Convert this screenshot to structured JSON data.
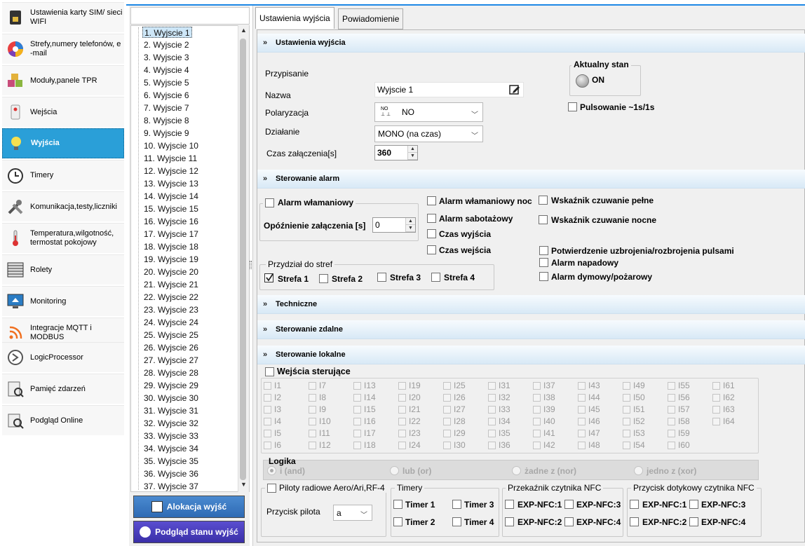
{
  "nav": [
    {
      "label": "Ustawienia karty SIM/ sieci\nWIFI",
      "icon": "sim-card-icon"
    },
    {
      "label": "Strefy,numery telefonów, e\n-mail",
      "icon": "pie-chart-icon"
    },
    {
      "label": "Moduły,panele TPR",
      "icon": "modules-boxes-icon"
    },
    {
      "label": "Wejścia",
      "icon": "sensor-icon"
    },
    {
      "label": "Wyjścia",
      "icon": "lightbulb-icon"
    },
    {
      "label": "Timery",
      "icon": "alarm-clock-icon"
    },
    {
      "label": "Komunikacja,testy,liczniki",
      "icon": "tools-icon"
    },
    {
      "label": "Temperatura,wilgotność,\ntermostat pokojowy",
      "icon": "thermometer-icon"
    },
    {
      "label": "Rolety",
      "icon": "roller-blind-icon"
    },
    {
      "label": "Monitoring",
      "icon": "monitor-house-icon"
    },
    {
      "label": "Integracje MQTT i\nMODBUS",
      "icon": "rss-icon"
    },
    {
      "label": "LogicProcessor",
      "icon": "logic-processor-icon"
    },
    {
      "label": "Pamięć zdarzeń",
      "icon": "event-memory-icon"
    },
    {
      "label": "Podgląd Online",
      "icon": "online-preview-icon"
    }
  ],
  "outputs": [
    "1. Wyjscie 1",
    "2. Wyjscie 2",
    "3. Wyjscie 3",
    "4. Wyjscie 4",
    "5. Wyjscie 5",
    "6. Wyjscie 6",
    "7. Wyjscie 7",
    "8. Wyjscie 8",
    "9. Wyjscie 9",
    "10. Wyjscie 10",
    "11. Wyjscie 11",
    "12. Wyjscie 12",
    "13. Wyjscie 13",
    "14. Wyjscie 14",
    "15. Wyjscie 15",
    "16. Wyjscie 16",
    "17. Wyjscie 17",
    "18. Wyjscie 18",
    "19. Wyjscie 19",
    "20. Wyjscie 20",
    "21. Wyjscie 21",
    "22. Wyjscie 22",
    "23. Wyjscie 23",
    "24. Wyjscie 24",
    "25. Wyjscie 25",
    "26. Wyjscie 26",
    "27. Wyjscie 27",
    "28. Wyjscie 28",
    "29. Wyjscie 29",
    "30. Wyjscie 30",
    "31. Wyjscie 31",
    "32. Wyjscie 32",
    "33. Wyjscie 33",
    "34. Wyjscie 34",
    "35. Wyjscie 35",
    "36. Wyjscie 36",
    "37. Wyjscie 37"
  ],
  "buttons": {
    "alokacja": "Alokacja wyjść",
    "podglad": "Podgląd stanu wyjść"
  },
  "tabs": {
    "settings": "Ustawienia wyjścia",
    "notify": "Powiadomienie"
  },
  "sections": {
    "settings": "Ustawienia wyjścia",
    "alarm": "Sterowanie alarm",
    "technical": "Techniczne",
    "remote": "Sterowanie zdalne",
    "local": "Sterowanie lokalne"
  },
  "settings": {
    "assign_label": "Przypisanie",
    "name_label": "Nazwa",
    "name_value": "Wyjscie 1",
    "polar_label": "Polaryzacja",
    "polar_icon_text": "NO",
    "polar_value": "NO",
    "action_label": "Działanie",
    "action_value": "MONO (na czas)",
    "time_label": "Czas załączenia[s]",
    "time_value": "360",
    "state_group": "Aktualny stan",
    "state_value": "ON",
    "pulse_label": "Pulsowanie ~1s/1s"
  },
  "alarm": {
    "burglary_group": "Alarm włamaniowy",
    "delay_label": "Opóźnienie  załączenia [s]",
    "delay_value": "0",
    "mid": [
      "Alarm włamaniowy noc",
      "Alarm sabotażowy",
      "Czas wyjścia",
      "Czas wejścia"
    ],
    "right": [
      "Wskaźnik czuwanie pełne",
      "Wskaźnik czuwanie nocne"
    ],
    "right2": [
      "Potwierdzenie uzbrojenia/rozbrojenia pulsami",
      "Alarm napadowy",
      "Alarm dymowy/pożarowy"
    ],
    "zones_group": "Przydział do stref",
    "zones": [
      {
        "label": "Strefa 1",
        "checked": true
      },
      {
        "label": "Strefa 2",
        "checked": false
      },
      {
        "label": "Strefa 3",
        "checked": false
      },
      {
        "label": "Strefa 4",
        "checked": false
      }
    ]
  },
  "local": {
    "inputs_label": "Wejścia sterujące",
    "inputs_columns": [
      [
        "I1",
        "I2",
        "I3",
        "I4",
        "I5",
        "I6"
      ],
      [
        "I7",
        "I8",
        "I9",
        "I10",
        "I11",
        "I12"
      ],
      [
        "I13",
        "I14",
        "I15",
        "I16",
        "I17",
        "I18"
      ],
      [
        "I19",
        "I20",
        "I21",
        "I22",
        "I23",
        "I24"
      ],
      [
        "I25",
        "I26",
        "I27",
        "I28",
        "I29",
        "I30"
      ],
      [
        "I31",
        "I32",
        "I33",
        "I34",
        "I35",
        "I36"
      ],
      [
        "I37",
        "I38",
        "I39",
        "I40",
        "I41",
        "I42"
      ],
      [
        "I43",
        "I44",
        "I45",
        "I46",
        "I47",
        "I48"
      ],
      [
        "I49",
        "I50",
        "I51",
        "I52",
        "I53",
        "I54"
      ],
      [
        "I55",
        "I56",
        "I57",
        "I58",
        "I59",
        "I60"
      ],
      [
        "I61",
        "I62",
        "I63",
        "I64"
      ]
    ],
    "logic_label": "Logika",
    "logic_options": [
      "i (and)",
      "lub (or)",
      "żadne z (nor)",
      "jedno z (xor)"
    ],
    "remotes_label": "Piloty radiowe Aero/Ari,RF-4",
    "remote_button_label": "Przycisk pilota",
    "remote_button_value": "a",
    "timers_group": "Timery",
    "timers": [
      "Timer 1",
      "Timer 2",
      "Timer 3",
      "Timer 4"
    ],
    "nfc_relay_group": "Przekaźnik czytnika NFC",
    "nfc_relay": [
      "EXP-NFC:1",
      "EXP-NFC:2",
      "EXP-NFC:3",
      "EXP-NFC:4"
    ],
    "nfc_touch_group": "Przycisk dotykowy czytnika NFC",
    "nfc_touch": [
      "EXP-NFC:1",
      "EXP-NFC:2",
      "EXP-NFC:3",
      "EXP-NFC:4"
    ]
  },
  "colors": {
    "accent": "#2a9fd8",
    "section_gradient_end": "#d8e9f6",
    "button_blue": "#3a79c2",
    "button_purple": "#4b3fb7"
  }
}
